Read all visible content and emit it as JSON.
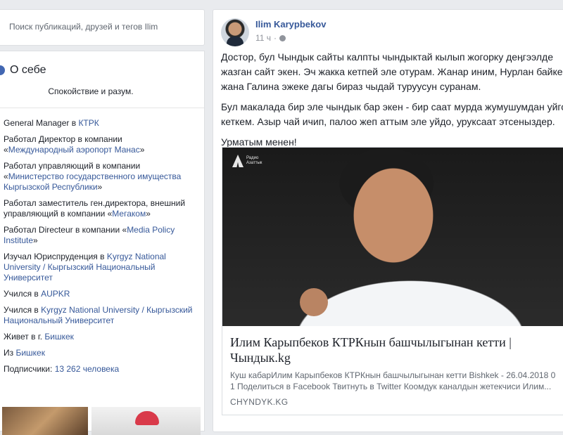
{
  "search": {
    "placeholder": "Поиск публикаций, друзей и тегов Ilim"
  },
  "about": {
    "title": "О себе",
    "bio": "Спокойствие и разум.",
    "items": [
      {
        "prefix": "General Manager в ",
        "link": "КТРК",
        "suffix": ""
      },
      {
        "prefix": "Работал Директор в компании «",
        "link": "Международный аэропорт Манас",
        "suffix": "»"
      },
      {
        "prefix": "Работал управляющий в компании «",
        "link": "Министерство государственного имущества Кыргызской Республики",
        "suffix": "»"
      },
      {
        "prefix": "Работал заместитель ген.директора, внешний управляющий в компании «",
        "link": "Мегаком",
        "suffix": "»"
      },
      {
        "prefix": "Работал Directeur в компании «",
        "link": "Media Policy Institute",
        "suffix": "»"
      },
      {
        "prefix": "Изучал Юриспруденция в ",
        "link": "Kyrgyz National University / Кыргызский Национальный Университет",
        "suffix": ""
      },
      {
        "prefix": "Учился в ",
        "link": "AUPKR",
        "suffix": ""
      },
      {
        "prefix": "Учился в ",
        "link": "Kyrgyz National University / Кыргызский Национальный Университет",
        "suffix": ""
      },
      {
        "prefix": "Живет в г. ",
        "link": "Бишкек",
        "suffix": ""
      },
      {
        "prefix": "Из ",
        "link": "Бишкек",
        "suffix": ""
      },
      {
        "prefix": "Подписчики: ",
        "link": "13 262 человека",
        "suffix": ""
      }
    ]
  },
  "post": {
    "author": "Ilim Karypbekov",
    "time": "11 ч",
    "paragraphs": [
      "Достор, бул Чындык сайты калпты чындыктай кылып жогорку деӊгээлде жазган сайт экен. Эч жакка кетпей эле отурам. Жанар иним, Нурлан байкем жана Галина эжеке дагы бираз чыдай туруусун суранам.",
      "Бул макалада бир эле чындык бар экен - бир саат мурда жумушумдан уйго кеткем. Азыр чай ичип, палоо жеп аттым эле уйдо, уруксаат этсеныздер.",
      "Урматым менен!"
    ],
    "link": {
      "logo_line1": "Радио",
      "logo_line2": "Азаттык",
      "title": "Илим Карыпбеков КТРКнын башчылыгынан кетти | Чындык.kg",
      "description": "Куш кабарИлим Карыпбеков КТРКнын башчылыгынан кетти Bishkek - 26.04.2018 0 1 Поделиться в Facebook Твитнуть в Twitter Коомдук каналдын жетекчиси Илим...",
      "domain": "CHYNDYK.KG"
    }
  }
}
